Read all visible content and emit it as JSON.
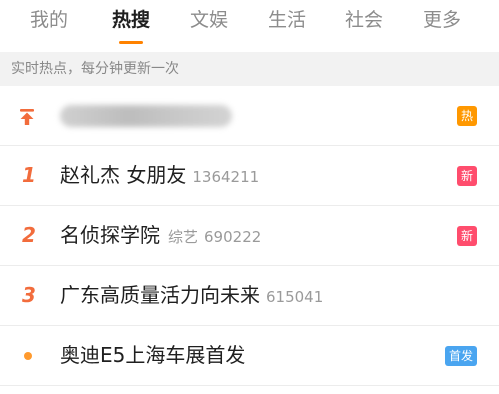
{
  "tabs": [
    {
      "label": "我的"
    },
    {
      "label": "热搜"
    },
    {
      "label": "文娱"
    },
    {
      "label": "生活"
    },
    {
      "label": "社会"
    },
    {
      "label": "更多"
    }
  ],
  "active_tab": "热搜",
  "subheader": "实时热点，每分钟更新一次",
  "colors": {
    "accent": "#ff8200",
    "rank": "#f26c3c",
    "badge_hot": "#ff9800",
    "badge_new": "#ff4d6d",
    "badge_first": "#4aa5f0",
    "dot": "#ff9a2e"
  },
  "items": [
    {
      "rank_icon": "pin-top-icon",
      "title_blurred": true,
      "badge": "热"
    },
    {
      "rank": "1",
      "title": "赵礼杰 女朋友",
      "count": "1364211",
      "badge": "新"
    },
    {
      "rank": "2",
      "title": "名侦探学院",
      "category": "综艺",
      "count": "690222",
      "badge": "新"
    },
    {
      "rank": "3",
      "title": "广东高质量活力向未来",
      "count": "615041"
    },
    {
      "rank_icon": "dot-icon",
      "title": "奥迪E5上海车展首发",
      "badge": "首发"
    }
  ]
}
